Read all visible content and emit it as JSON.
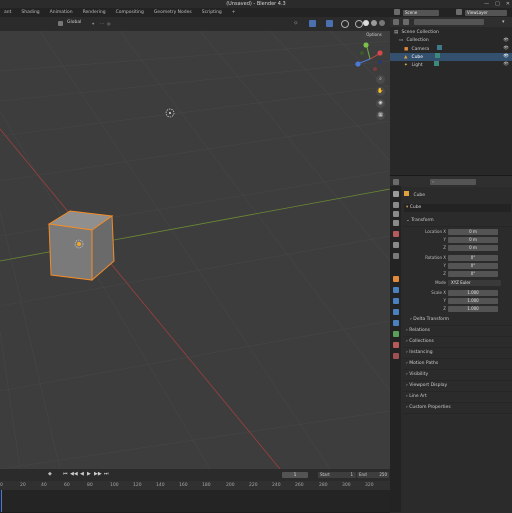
{
  "window": {
    "title": "(Unsaved) - Blender 4.3",
    "min_icon": "minimize-icon",
    "max_icon": "maximize-icon",
    "close_icon": "close-icon"
  },
  "workspaces": [
    {
      "label": "ant",
      "active": false
    },
    {
      "label": "Shading",
      "active": false
    },
    {
      "label": "Animation",
      "active": false
    },
    {
      "label": "Rendering",
      "active": false
    },
    {
      "label": "Compositing",
      "active": false
    },
    {
      "label": "Geometry Nodes",
      "active": false
    },
    {
      "label": "Scripting",
      "active": false
    },
    {
      "label": "+",
      "active": false
    }
  ],
  "scene_header": {
    "scene_name": "Scene",
    "view_layer": "ViewLayer"
  },
  "viewport_header": {
    "transform_orientation": "Global",
    "options_label": "Options",
    "shading_modes": [
      "wireframe",
      "solid",
      "material",
      "rendered"
    ]
  },
  "outliner": {
    "search_placeholder": "",
    "items": [
      {
        "label": "Scene Collection",
        "indent": 0,
        "icon": "scene-collection-icon",
        "selected": false
      },
      {
        "label": "Collection",
        "indent": 1,
        "icon": "collection-icon",
        "selected": false
      },
      {
        "label": "Camera",
        "indent": 2,
        "icon": "camera-icon",
        "selected": false
      },
      {
        "label": "Cube",
        "indent": 2,
        "icon": "mesh-icon",
        "selected": true
      },
      {
        "label": "Light",
        "indent": 2,
        "icon": "light-icon",
        "selected": false
      }
    ]
  },
  "properties": {
    "object_name": "Cube",
    "object_name_field": "Cube",
    "transform_label": "Transform",
    "location": {
      "label": "Location X",
      "x": "0 m",
      "y": "0 m",
      "z": "0 m"
    },
    "rotation": {
      "label": "Rotation X",
      "x": "0°",
      "y": "0°",
      "z": "0°"
    },
    "mode_label": "Mode",
    "mode_value": "XYZ Euler",
    "scale": {
      "label": "Scale X",
      "x": "1.000",
      "y": "1.000",
      "z": "1.000"
    },
    "axis_y": "Y",
    "axis_z": "Z",
    "delta_transform": "Delta Transform",
    "panels": [
      "Relations",
      "Collections",
      "Instancing",
      "Motion Paths",
      "Visibility",
      "Viewport Display",
      "Line Art",
      "Custom Properties"
    ]
  },
  "timeline": {
    "current_frame": "1",
    "start_label": "Start",
    "start_value": "1",
    "end_label": "End",
    "end_value": "250",
    "ruler_ticks": [
      "0",
      "20",
      "40",
      "60",
      "80",
      "100",
      "120",
      "140",
      "160",
      "180",
      "200",
      "220",
      "240"
    ]
  },
  "colors": {
    "selection_outline": "#f28c28",
    "x_axis": "#b84a4a",
    "y_axis": "#7b9a3a",
    "outliner_selected": "#33506e"
  }
}
